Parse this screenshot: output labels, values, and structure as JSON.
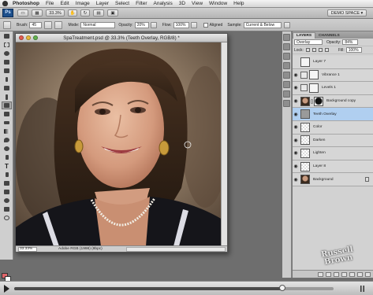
{
  "menubar": {
    "app": "Photoshop",
    "items": [
      "File",
      "Edit",
      "Image",
      "Layer",
      "Select",
      "Filter",
      "Analysis",
      "3D",
      "View",
      "Window",
      "Help"
    ]
  },
  "appbar": {
    "logo": "Ps",
    "zoom": "33.3%",
    "workspace": "DEMO SPACE ▾"
  },
  "options": {
    "brush_label": "Brush:",
    "brush_size": "45",
    "mode_label": "Mode:",
    "mode_value": "Normal",
    "opacity_label": "Opacity:",
    "opacity_value": "20%",
    "flow_label": "Flow:",
    "flow_value": "100%",
    "aligned_label": "Aligned",
    "sample_label": "Sample:",
    "sample_value": "Current & Below"
  },
  "document": {
    "title": "SpaTreatment.psd @ 33.3% (Teeth Overlay, RGB/8) *",
    "zoom": "33.33%",
    "profile": "Adobe RGB (1998) (8bpc)"
  },
  "layers_panel": {
    "tabs": [
      "LAYERS",
      "CHANNELS"
    ],
    "blend_mode": "Overlay",
    "opacity_label": "Opacity:",
    "opacity_value": "84%",
    "lock_label": "Lock:",
    "fill_label": "Fill:",
    "fill_value": "100%",
    "layers": [
      {
        "name": "Layer 7",
        "thumb": "white",
        "visible": false,
        "selected": false
      },
      {
        "name": "Vibrance 1",
        "thumb": "adj",
        "visible": true,
        "selected": false
      },
      {
        "name": "Levels 1",
        "thumb": "adj",
        "visible": true,
        "selected": false
      },
      {
        "name": "Background copy",
        "thumb": "photo",
        "visible": true,
        "selected": false
      },
      {
        "name": "Teeth Overlay",
        "thumb": "gray",
        "visible": true,
        "selected": true
      },
      {
        "name": "Color",
        "thumb": "trans",
        "visible": true,
        "selected": false
      },
      {
        "name": "Darken",
        "thumb": "trans",
        "visible": true,
        "selected": false
      },
      {
        "name": "Lighten",
        "thumb": "trans",
        "visible": true,
        "selected": false
      },
      {
        "name": "Layer 8",
        "thumb": "trans",
        "visible": true,
        "selected": false
      },
      {
        "name": "Background",
        "thumb": "photo",
        "visible": true,
        "selected": false
      }
    ]
  },
  "watermark": {
    "line1": "Russell",
    "line2": "Brown"
  },
  "player": {
    "progress": 0.84
  }
}
